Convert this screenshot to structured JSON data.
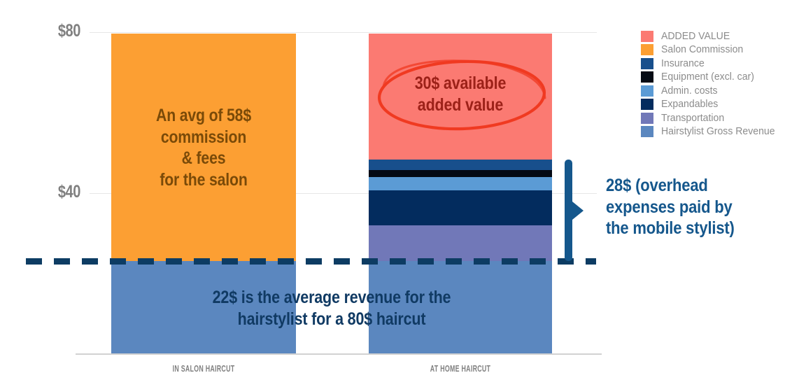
{
  "chart_data": {
    "type": "bar",
    "subtype": "stacked",
    "title": "",
    "xlabel": "",
    "ylabel": "",
    "ylim": [
      0,
      80
    ],
    "yticks": [
      {
        "value": 80,
        "label": "$80"
      },
      {
        "value": 40,
        "label": "$40"
      }
    ],
    "grid": true,
    "legend_position": "right",
    "categories": [
      "IN SALON HAIRCUT",
      "AT HOME HAIRCUT"
    ],
    "series": [
      {
        "name": "ADDED VALUE",
        "color": "#fb7a72",
        "values": [
          0,
          30
        ]
      },
      {
        "name": "Salon Commission",
        "color": "#fc9f33",
        "values": [
          58,
          0
        ]
      },
      {
        "name": "Insurance",
        "color": "#184f8c",
        "values": [
          0,
          2.6
        ]
      },
      {
        "name": "Equipment (excl. car)",
        "color": "#040a14",
        "values": [
          0,
          1.7
        ]
      },
      {
        "name": "Admin. costs",
        "color": "#5b9bd5",
        "values": [
          0,
          3.3
        ]
      },
      {
        "name": "Expandables",
        "color": "#032c5e",
        "values": [
          0,
          8.7
        ]
      },
      {
        "name": "Transportation",
        "color": "#7178b8",
        "values": [
          0,
          8.9
        ]
      },
      {
        "name": "Hairstylist Gross Revenue",
        "color": "#5b87bf",
        "values": [
          22,
          22
        ]
      }
    ],
    "annotations": [
      {
        "id": "salon-commission-note",
        "text": "An avg of 58$ commission & fees for the salon"
      },
      {
        "id": "added-value-note",
        "text": "30$ available added value"
      },
      {
        "id": "gross-revenue-note",
        "text": "22$ is the average revenue for the hairstylist for a 80$ haircut"
      },
      {
        "id": "overhead-note",
        "text": "28$ (overhead expenses paid by the mobile stylist)"
      }
    ]
  },
  "axis": {
    "y_tick_top": "$80",
    "y_tick_mid": "$40",
    "x_tick_left": "IN SALON HAIRCUT",
    "x_tick_right": "AT HOME HAIRCUT"
  },
  "annotations": {
    "salon": {
      "line1": "An avg of 58$",
      "line2": "commission",
      "line3": "& fees",
      "line4": "for the salon"
    },
    "added_value": {
      "line1": "30$ available",
      "line2": "added value"
    },
    "gross_revenue": {
      "line1": "22$ is the average revenue for the",
      "line2": "hairstylist for a 80$ haircut"
    },
    "overhead": {
      "line1": "28$ (overhead",
      "line2": "expenses paid by",
      "line3": "the mobile stylist)"
    }
  },
  "legend": {
    "items": [
      {
        "label": "ADDED VALUE",
        "color": "#fb7a72"
      },
      {
        "label": "Salon Commission",
        "color": "#fc9f33"
      },
      {
        "label": "Insurance",
        "color": "#184f8c"
      },
      {
        "label": "Equipment (excl. car)",
        "color": "#040a14"
      },
      {
        "label": "Admin. costs",
        "color": "#5b9bd5"
      },
      {
        "label": "Expandables",
        "color": "#032c5e"
      },
      {
        "label": "Transportation",
        "color": "#7178b8"
      },
      {
        "label": "Hairstylist Gross Revenue",
        "color": "#5b87bf"
      }
    ]
  },
  "colors": {
    "dashed_separator": "#0d3c63",
    "bracket": "#15578c",
    "circle_highlight": "#f03a21",
    "gridline": "#e6e6e6",
    "tick_text": "#808080"
  }
}
